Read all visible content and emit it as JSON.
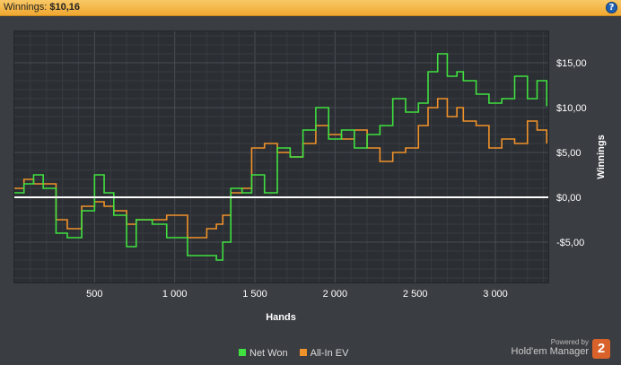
{
  "header": {
    "title_label": "Winnings:",
    "title_value": "$10,16",
    "help_icon": "?"
  },
  "chart_data": {
    "type": "line",
    "xlabel": "Hands",
    "ylabel": "Winnings",
    "xlim": [
      0,
      3330
    ],
    "ylim": [
      -9.5,
      18.5
    ],
    "x_ticks": [
      500,
      1000,
      1500,
      2000,
      2500,
      3000
    ],
    "x_tick_labels": [
      "500",
      "1 000",
      "1 500",
      "2 000",
      "2 500",
      "3 000"
    ],
    "y_ticks": [
      -5,
      0,
      5,
      10,
      15
    ],
    "y_tick_labels": [
      "-$5,00",
      "$0,00",
      "$5,00",
      "$10,00",
      "$15,00"
    ],
    "grid": true,
    "zero_line_color": "#ffffff",
    "series": [
      {
        "name": "Net Won",
        "color": "#40e040",
        "x": [
          0,
          60,
          120,
          180,
          260,
          330,
          420,
          500,
          560,
          620,
          700,
          760,
          860,
          950,
          1080,
          1200,
          1260,
          1300,
          1350,
          1420,
          1480,
          1560,
          1640,
          1720,
          1800,
          1880,
          1960,
          2040,
          2120,
          2200,
          2280,
          2360,
          2440,
          2520,
          2580,
          2640,
          2700,
          2760,
          2800,
          2880,
          2960,
          3040,
          3120,
          3200,
          3260,
          3320
        ],
        "y": [
          0.5,
          1.5,
          2.5,
          1.0,
          -4.0,
          -4.5,
          -1.5,
          2.5,
          0.5,
          -2.0,
          -5.5,
          -2.5,
          -3.0,
          -4.5,
          -6.5,
          -6.5,
          -7.0,
          -5.0,
          1.0,
          0.5,
          2.5,
          0.5,
          5.5,
          4.5,
          7.5,
          10.0,
          6.5,
          7.5,
          5.5,
          7.0,
          8.0,
          11.0,
          9.5,
          10.5,
          14.0,
          16.0,
          13.5,
          14.0,
          13.0,
          11.5,
          10.5,
          11.0,
          13.5,
          11.0,
          13.0,
          10.16
        ]
      },
      {
        "name": "All-In EV",
        "color": "#f0922a",
        "x": [
          0,
          60,
          120,
          180,
          260,
          330,
          420,
          500,
          560,
          620,
          700,
          760,
          860,
          950,
          1080,
          1200,
          1260,
          1300,
          1350,
          1420,
          1480,
          1560,
          1640,
          1720,
          1800,
          1880,
          1960,
          2040,
          2120,
          2200,
          2280,
          2360,
          2440,
          2520,
          2580,
          2640,
          2700,
          2760,
          2800,
          2880,
          2960,
          3040,
          3120,
          3200,
          3260,
          3320
        ],
        "y": [
          1.0,
          2.0,
          1.5,
          1.5,
          -2.5,
          -3.5,
          -1.0,
          -0.5,
          -1.0,
          -1.5,
          -3.0,
          -2.5,
          -2.5,
          -2.0,
          -4.5,
          -3.5,
          -3.0,
          -2.0,
          0.5,
          1.0,
          5.5,
          6.0,
          5.0,
          4.5,
          6.0,
          8.0,
          7.0,
          6.5,
          7.5,
          5.5,
          4.0,
          5.0,
          5.5,
          8.0,
          10.0,
          11.0,
          9.0,
          10.0,
          8.5,
          8.0,
          5.5,
          6.5,
          6.0,
          8.5,
          7.5,
          6.0
        ]
      }
    ]
  },
  "legend": {
    "net_won": "Net Won",
    "all_in_ev": "All-In EV"
  },
  "brand": {
    "powered_by": "Powered by",
    "name": "Hold'em Manager",
    "badge": "2"
  }
}
